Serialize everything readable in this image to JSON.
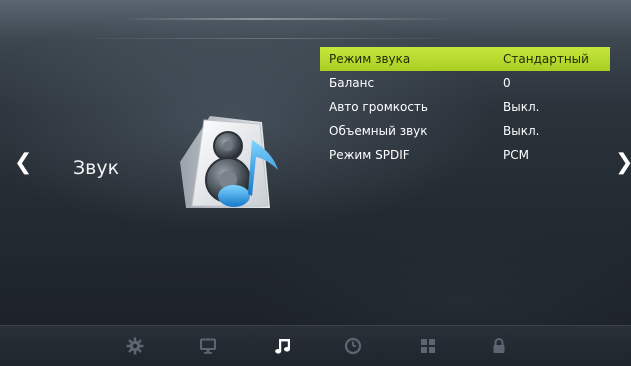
{
  "section": {
    "title": "Звук",
    "icon": "speaker-music-icon"
  },
  "nav": {
    "left_arrow": "❮",
    "right_arrow": "❯"
  },
  "menu": {
    "items": [
      {
        "label": "Режим звука",
        "value": "Стандартный",
        "selected": true
      },
      {
        "label": "Баланс",
        "value": "0",
        "selected": false
      },
      {
        "label": "Авто громкость",
        "value": "Выкл.",
        "selected": false
      },
      {
        "label": "Объемный звук",
        "value": "Выкл.",
        "selected": false
      },
      {
        "label": "Режим SPDIF",
        "value": "PCM",
        "selected": false
      }
    ]
  },
  "bottom_tabs": [
    {
      "icon": "gear-icon",
      "active": false
    },
    {
      "icon": "monitor-icon",
      "active": false
    },
    {
      "icon": "music-note-icon",
      "active": true
    },
    {
      "icon": "clock-icon",
      "active": false
    },
    {
      "icon": "grid-icon",
      "active": false
    },
    {
      "icon": "lock-icon",
      "active": false
    }
  ],
  "colors": {
    "highlight": "#b8db2f",
    "text": "#ffffff",
    "icon_inactive": "#5d6670",
    "icon_active": "#ffffff"
  }
}
